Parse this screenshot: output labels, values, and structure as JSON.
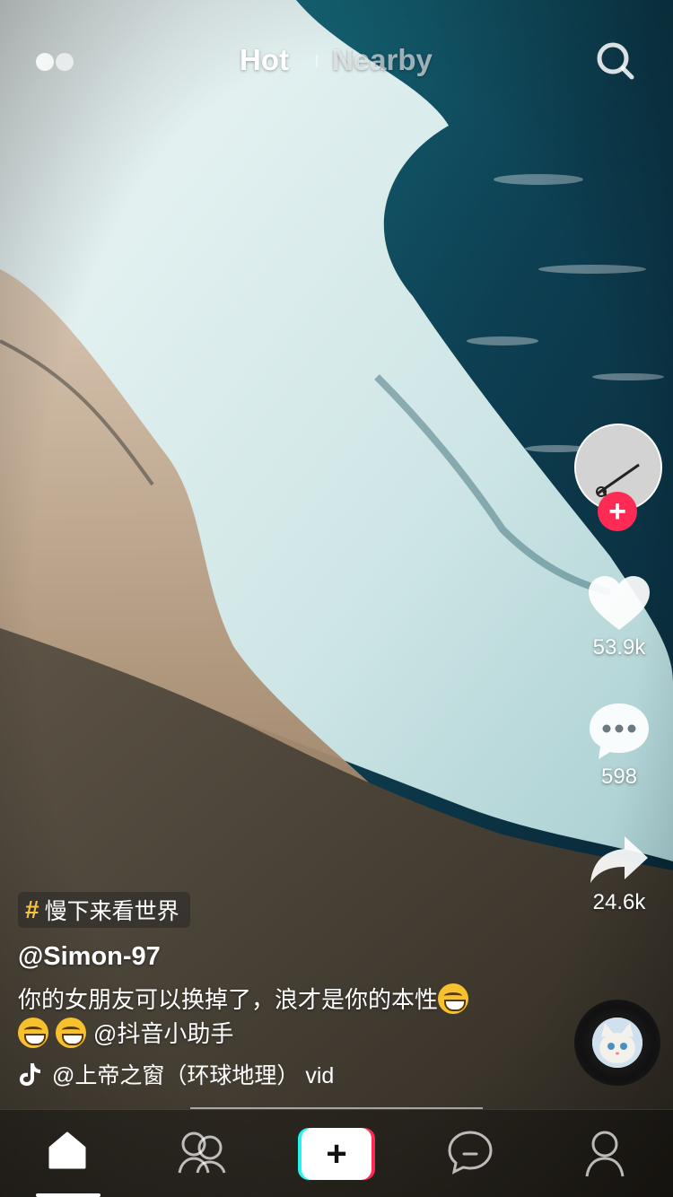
{
  "header": {
    "tab_hot": "Hot",
    "tab_nearby": "Nearby",
    "live_icon": "live-dots-icon",
    "search_icon": "search-icon"
  },
  "side_actions": {
    "likes": "53.9k",
    "comments": "598",
    "shares": "24.6k",
    "follow_label": "+"
  },
  "video": {
    "topic": "慢下来看世界",
    "topic_prefix": "#",
    "username": "@Simon-97",
    "caption_text": "你的女朋友可以换掉了，浪才是你的本性",
    "caption_emojis": 3,
    "caption_mention": "@抖音小助手",
    "music": "@上帝之窗（环球地理） vid"
  },
  "nav": {
    "plus_label": "+",
    "items": [
      "home-icon",
      "friends-icon",
      "create-button",
      "inbox-icon",
      "profile-icon"
    ]
  },
  "colors": {
    "accent_red": "#fe2c55",
    "accent_cyan": "#25f4ee",
    "topic_yellow": "#f6c344"
  }
}
